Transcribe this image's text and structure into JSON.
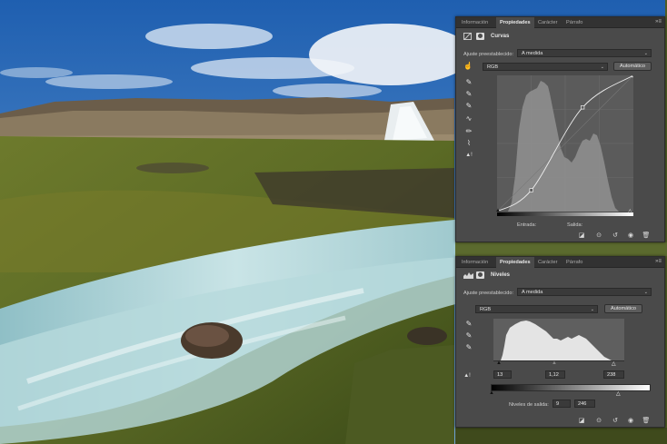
{
  "curves_panel": {
    "tabs": [
      "Información",
      "Propiedades",
      "Carácter",
      "Párrafo"
    ],
    "active_tab": 1,
    "menu_glyph": "»≡",
    "adjustment_title": "Curvas",
    "preset_label": "Ajuste preestablecido:",
    "preset_value": "A medida",
    "channel_value": "RGB",
    "auto_label": "Automático",
    "input_label": "Entrada:",
    "output_label": "Salida:",
    "tools": [
      "eyedropper-black-icon",
      "eyedropper-gray-icon",
      "eyedropper-white-icon",
      "curve-points-icon",
      "pencil-icon",
      "smooth-icon",
      "warning-icon"
    ],
    "curve_points": [
      [
        0,
        0
      ],
      [
        64,
        40
      ],
      [
        160,
        195
      ],
      [
        255,
        255
      ]
    ],
    "footer_icons": [
      "clip-icon",
      "view-previous-icon",
      "reset-icon",
      "visibility-icon",
      "trash-icon"
    ]
  },
  "levels_panel": {
    "tabs": [
      "Información",
      "Propiedades",
      "Carácter",
      "Párrafo"
    ],
    "active_tab": 1,
    "menu_glyph": "»≡",
    "adjustment_title": "Niveles",
    "preset_label": "Ajuste preestablecido:",
    "preset_value": "A medida",
    "channel_value": "RGB",
    "auto_label": "Automático",
    "input_black": "13",
    "input_gamma": "1,12",
    "input_white": "238",
    "output_label": "Niveles de salida:",
    "output_black": "9",
    "output_white": "246",
    "tools": [
      "eyedropper-black-icon",
      "eyedropper-gray-icon",
      "eyedropper-white-icon",
      "warning-icon"
    ],
    "footer_icons": [
      "clip-icon",
      "view-previous-icon",
      "reset-icon",
      "visibility-icon",
      "trash-icon"
    ]
  },
  "colors": {
    "panel_bg": "#4a4a4a",
    "tab_bg": "#323232",
    "graph_bg": "#5b5b5b",
    "histogram": "#8a8a8a",
    "levels_histogram": "#e6e6e6"
  }
}
